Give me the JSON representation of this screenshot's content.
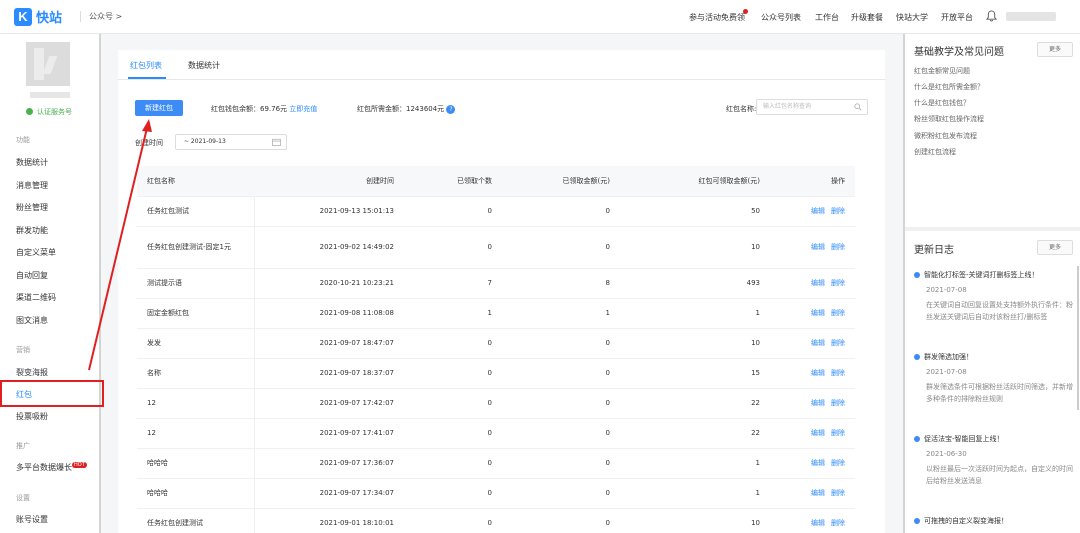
{
  "topbar": {
    "logo_text": "快站",
    "breadcrumb": "公众号 >",
    "nav": [
      "参与活动免费领",
      "公众号列表",
      "工作台",
      "升级套餐",
      "快站大学",
      "开放平台"
    ]
  },
  "sidebar": {
    "verified": "认证服务号",
    "sections": [
      {
        "title": "功能",
        "items": [
          "数据统计",
          "消息管理",
          "粉丝管理",
          "群发功能",
          "自定义菜单",
          "自动回复",
          "渠道二维码",
          "图文消息"
        ]
      },
      {
        "title": "营销",
        "items": [
          "裂变海报",
          "红包",
          "投票吸粉"
        ]
      },
      {
        "title": "推广",
        "items": [
          "多平台数据爆长"
        ]
      },
      {
        "title": "设置",
        "items": [
          "账号设置"
        ]
      }
    ],
    "hot_badge": "HOT"
  },
  "main": {
    "tabs": [
      "红包列表",
      "数据统计"
    ],
    "new_button": "新建红包",
    "balance_label": "红包钱包余额：",
    "balance_value": "69.76元",
    "recharge": "立即充值",
    "needed_label": "红包所需金额：",
    "needed_value": "1243604元",
    "search_label": "红包名称:",
    "search_placeholder": "输入红包名称查询",
    "date_label": "创建时间",
    "date_value": "~ 2021-09-13",
    "table": {
      "headers": [
        "红包名称",
        "创建时间",
        "已领取个数",
        "已领取金额(元)",
        "红包可领取金额(元)",
        "操作"
      ],
      "rows": [
        [
          "任务红包测试",
          "2021-09-13 15:01:13",
          "0",
          "0",
          "50"
        ],
        [
          "任务红包创建测试-固定1元",
          "2021-09-02 14:49:02",
          "0",
          "0",
          "10"
        ],
        [
          "测试提示语",
          "2020-10-21 10:23:21",
          "7",
          "8",
          "493"
        ],
        [
          "固定金额红包",
          "2021-09-08 11:08:08",
          "1",
          "1",
          "1"
        ],
        [
          "发发",
          "2021-09-07 18:47:07",
          "0",
          "0",
          "10"
        ],
        [
          "名称",
          "2021-09-07 18:37:07",
          "0",
          "0",
          "15"
        ],
        [
          "12",
          "2021-09-07 17:42:07",
          "0",
          "0",
          "22"
        ],
        [
          "12",
          "2021-09-07 17:41:07",
          "0",
          "0",
          "22"
        ],
        [
          "哈哈哈",
          "2021-09-07 17:36:07",
          "0",
          "0",
          "1"
        ],
        [
          "哈哈哈",
          "2021-09-07 17:34:07",
          "0",
          "0",
          "1"
        ],
        [
          "任务红包创建测试",
          "2021-09-01 18:10:01",
          "0",
          "0",
          "10"
        ]
      ],
      "edit": "编辑",
      "delete": "删除"
    }
  },
  "right": {
    "faq_title": "基础教学及常见问题",
    "more": "更多",
    "faq": [
      "红包金额常见问题",
      "什么是红包所需金额？",
      "什么是红包钱包？",
      "粉丝领取红包操作流程",
      "微积粉红包发布流程",
      "创建红包流程"
    ],
    "log_title": "更新日志",
    "logs": [
      {
        "title": "智能化打标签-关键词打删标签上线！",
        "date": "2021-07-08",
        "desc": "在关键词自动回复设置处支持额外执行条件：粉丝发送关键词后自动对该粉丝打/删标签"
      },
      {
        "title": "群发筛选加强！",
        "date": "2021-07-08",
        "desc": "群发筛选条件可根据粉丝活跃时间筛选，并新增多种条件的排除粉丝规则"
      },
      {
        "title": "促活法宝-智能回复上线！",
        "date": "2021-06-30",
        "desc": "以粉丝最后一次活跃时间为起点，自定义的时间后给粉丝发送消息"
      },
      {
        "title": "可拖拽的自定义裂变海报！",
        "date": "",
        "desc": ""
      }
    ]
  }
}
